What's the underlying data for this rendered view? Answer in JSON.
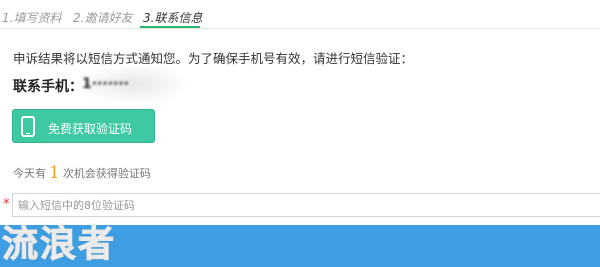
{
  "steps": {
    "step1": "1.填写资料",
    "step2": "2.邀请好友",
    "step3": "3.联系信息"
  },
  "notice": "申诉结果将以短信方式通知您。为了确保手机号有效，请进行短信验证：",
  "phone": {
    "label": "联系手机：",
    "value": "1·······"
  },
  "sms_button": {
    "label": "免费获取验证码",
    "icon": "mobile-phone-icon"
  },
  "attempts": {
    "prefix": "今天有",
    "count": "1",
    "suffix": "次机会获得验证码"
  },
  "code_input": {
    "required_mark": "*",
    "placeholder": "输入短信中的8位验证码",
    "value": ""
  },
  "watermark": "流浪者",
  "colors": {
    "active_step_underline": "#2bb673",
    "sms_button_bg": "#3ec9a3",
    "count_color": "#f0a020",
    "submit_bar": "#3d9ee3",
    "required_star": "#ee3333"
  }
}
